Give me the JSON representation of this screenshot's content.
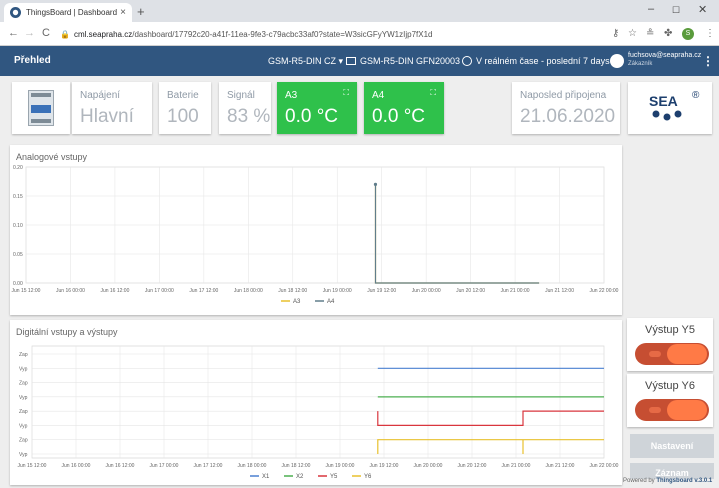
{
  "browser": {
    "tab_title": "ThingsBoard | Dashboard",
    "tab_close": "×",
    "new_tab": "+",
    "url_host": "cml.seapraha.cz",
    "url_path": "/dashboard/17792c20-a41f-11ea-9fe3-c79acbc33af0?state=W3sicGFyYW1zIjp7fX1d",
    "min": "–",
    "max": "☐",
    "close": "✕",
    "back": "←",
    "forward": "→",
    "reload": "C",
    "profile_initial": "S"
  },
  "header": {
    "title": "Přehled",
    "device_select": "GSM-R5-DIN CZ ▾",
    "device_name": "GSM-R5-DIN GFN20003",
    "time_window": "V reálném čase - poslední 7 days",
    "user_email": "fuchsova@seapraha.cz",
    "user_role": "Zákazník",
    "more": "⋮"
  },
  "cards": {
    "napajeni": {
      "label": "Napájení",
      "value": "Hlavní"
    },
    "baterie": {
      "label": "Baterie",
      "value": "100"
    },
    "signal": {
      "label": "Signál",
      "value": "83 %"
    },
    "a3": {
      "label": "A3",
      "value": "0.0 °C"
    },
    "a4": {
      "label": "A4",
      "value": "0.0 °C"
    },
    "posledni": {
      "label": "Naposled připojena",
      "value": "21.06.2020"
    },
    "logo_text": "SEA"
  },
  "colors": {
    "primary": "#305680",
    "green": "#2fc14b",
    "x1": "#4a80d1",
    "x2": "#4caf50",
    "y5": "#d9363e",
    "y6": "#e8c12e",
    "a4": "#607d8b"
  },
  "chart_data": [
    {
      "type": "line",
      "title": "Analogové vstupy",
      "x": [
        "Jun 15 12:00",
        "Jun 16 00:00",
        "Jun 16 12:00",
        "Jun 17 00:00",
        "Jun 17 12:00",
        "Jun 18 00:00",
        "Jun 18 12:00",
        "Jun 19 00:00",
        "Jun 19 12:00",
        "Jun 20 00:00",
        "Jun 20 12:00",
        "Jun 21 00:00",
        "Jun 21 12:00",
        "Jun 22 00:00"
      ],
      "y_ticks": [
        "0.20",
        "0.15",
        "0.10",
        "0.05",
        "0.00"
      ],
      "ylim": [
        0,
        0.2
      ],
      "series": [
        {
          "name": "A3",
          "color": "#e8c12e",
          "points": [
            [
              3.93,
              0.17
            ],
            [
              3.93,
              0.0
            ],
            [
              5.77,
              0.0
            ]
          ]
        },
        {
          "name": "A4",
          "color": "#607d8b",
          "points": [
            [
              3.93,
              0.17
            ],
            [
              3.93,
              0.0
            ],
            [
              5.77,
              0.0
            ]
          ]
        }
      ],
      "xlim": [
        0,
        6.5
      ],
      "legend": "bottom"
    },
    {
      "type": "line",
      "title": "Digitální vstupy a výstupy",
      "x": [
        "Jun 15 12:00",
        "Jun 16 00:00",
        "Jun 16 12:00",
        "Jun 17 00:00",
        "Jun 17 12:00",
        "Jun 18 00:00",
        "Jun 18 12:00",
        "Jun 19 00:00",
        "Jun 19 12:00",
        "Jun 20 00:00",
        "Jun 20 12:00",
        "Jun 21 00:00",
        "Jun 21 12:00",
        "Jun 22 00:00"
      ],
      "y_ticks": [
        "Zap",
        "Vyp",
        "Zap",
        "Vyp",
        "Zap",
        "Vyp",
        "Zap",
        "Vyp"
      ],
      "series": [
        {
          "name": "X1",
          "color": "#4a80d1",
          "steps": [
            [
              3.93,
              0
            ],
            [
              6.5,
              0
            ]
          ],
          "band": 0
        },
        {
          "name": "X2",
          "color": "#4caf50",
          "steps": [
            [
              3.93,
              0
            ],
            [
              6.5,
              0
            ]
          ],
          "band": 1
        },
        {
          "name": "Y5",
          "color": "#d9363e",
          "steps": [
            [
              3.93,
              1
            ],
            [
              3.93,
              0
            ],
            [
              5.58,
              0
            ],
            [
              5.58,
              1
            ],
            [
              6.5,
              1
            ]
          ],
          "band": 2
        },
        {
          "name": "Y6",
          "color": "#e8c12e",
          "steps": [
            [
              3.93,
              0
            ],
            [
              3.93,
              1
            ],
            [
              5.58,
              1
            ],
            [
              5.58,
              0
            ],
            [
              5.58,
              1
            ],
            [
              6.5,
              1
            ]
          ],
          "band": 3
        }
      ],
      "xlim": [
        0,
        6.5
      ],
      "legend": "bottom"
    }
  ],
  "switches": {
    "y5": "Výstup Y5",
    "y6": "Výstup Y6"
  },
  "buttons": {
    "settings": "Nastavení",
    "log": "Záznam"
  },
  "footer": {
    "powered": "Powered by ",
    "tb": "Thingsboard v.3.0.1"
  }
}
